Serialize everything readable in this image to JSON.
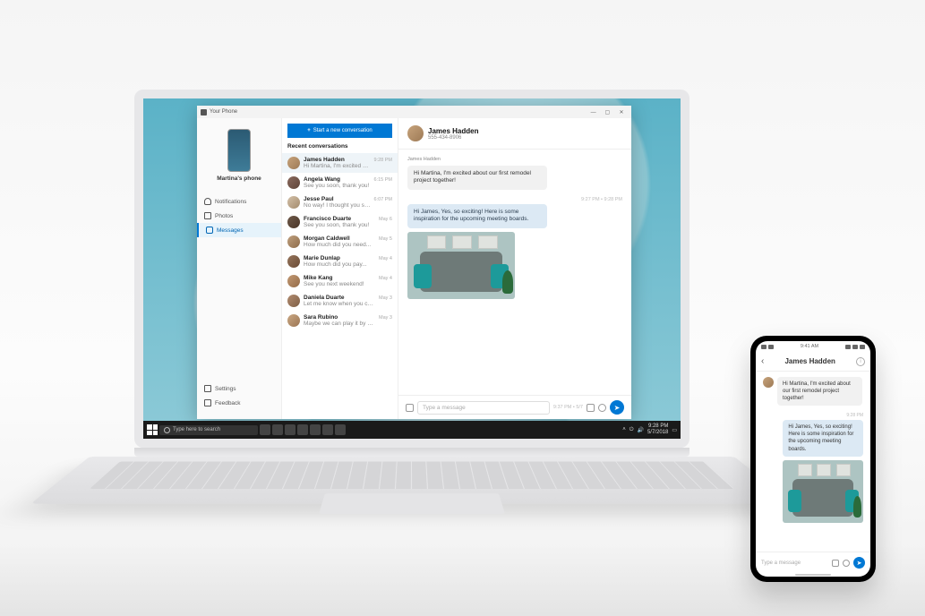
{
  "app": {
    "title": "Your Phone",
    "phone_label": "Martina's phone",
    "nav": {
      "notifications": "Notifications",
      "photos": "Photos",
      "messages": "Messages",
      "settings": "Settings",
      "feedback": "Feedback"
    },
    "new_conversation": "Start a new conversation",
    "recent_label": "Recent conversations"
  },
  "conversations": [
    {
      "name": "James Hadden",
      "preview": "Hi Martina, I'm excited about...",
      "time": "9:28 PM"
    },
    {
      "name": "Angela Wang",
      "preview": "See you soon, thank you!",
      "time": "6:15 PM"
    },
    {
      "name": "Jesse Paul",
      "preview": "No way! I thought you still...",
      "time": "6:07 PM"
    },
    {
      "name": "Francisco Duarte",
      "preview": "See you soon, thank you!",
      "time": "May 6"
    },
    {
      "name": "Morgan Caldwell",
      "preview": "How much did you need...",
      "time": "May 5"
    },
    {
      "name": "Marie Dunlap",
      "preview": "How much did you pay...",
      "time": "May 4"
    },
    {
      "name": "Mike Kang",
      "preview": "See you next weekend!",
      "time": "May 4"
    },
    {
      "name": "Daniela Duarte",
      "preview": "Let me know when you can...",
      "time": "May 3"
    },
    {
      "name": "Sara Rubino",
      "preview": "Maybe we can play it by ear",
      "time": "May 3"
    }
  ],
  "chat": {
    "contact_name": "James Hadden",
    "contact_phone": "555-434-8906",
    "thread_label": "James Hadden",
    "msg_in": "Hi Martina, I'm excited about our first remodel project together!",
    "reply_time": "9:27 PM • 9:28 PM",
    "msg_out": "Hi James,\nYes, so exciting! Here is some inspiration for the upcoming meeting boards.",
    "input_placeholder": "Type a message",
    "input_time": "9:37 PM • 5/7"
  },
  "taskbar": {
    "search_placeholder": "Type here to search",
    "time": "9:28 PM",
    "date": "5/7/2018"
  },
  "phone": {
    "status_time": "9:41 AM",
    "title": "James Hadden",
    "msg_in": "Hi Martina, I'm excited about our first remodel project together!",
    "reply_time": "9:28 PM",
    "msg_out": "Hi James,\nYes, so exciting! Here is some inspiration for the upcoming meeting boards.",
    "input_placeholder": "Type a message"
  }
}
